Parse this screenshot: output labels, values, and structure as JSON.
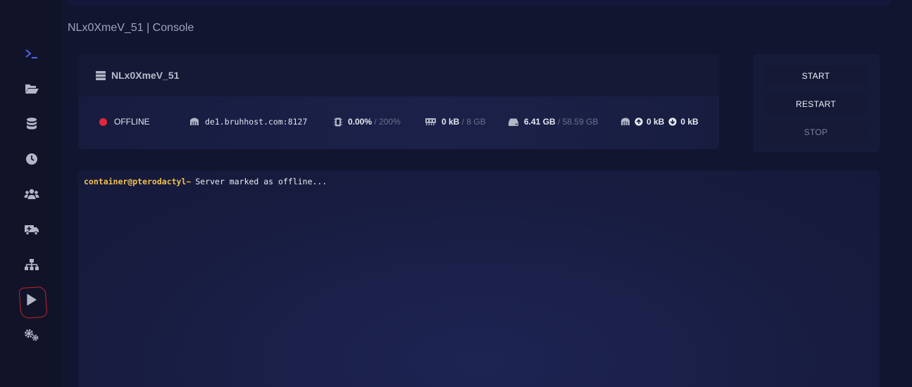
{
  "page": {
    "title": "NLx0XmeV_51 | Console"
  },
  "sidebar": {
    "items": [
      {
        "name": "console",
        "icon": "terminal-icon",
        "active": true
      },
      {
        "name": "files",
        "icon": "folder-open-icon"
      },
      {
        "name": "databases",
        "icon": "database-icon"
      },
      {
        "name": "schedules",
        "icon": "clock-icon"
      },
      {
        "name": "users",
        "icon": "users-icon"
      },
      {
        "name": "backups",
        "icon": "truck-icon"
      },
      {
        "name": "network",
        "icon": "network-icon"
      },
      {
        "name": "startup",
        "icon": "play-icon"
      },
      {
        "name": "settings",
        "icon": "cogs-icon"
      }
    ],
    "active_color": "#4f63e6",
    "icon_color": "#b2b6c6",
    "highlight_color": "#c2232f"
  },
  "server": {
    "name": "NLx0XmeV_51",
    "status": "OFFLINE",
    "status_color": "#e0293a",
    "address": "de1.bruhhost.com:8127",
    "cpu_value": "0.00%",
    "cpu_limit": "/ 200%",
    "memory_value": "0 kB",
    "memory_limit": "/ 8 GB",
    "disk_value": "6.41 GB",
    "disk_limit": "/ 58.59 GB",
    "net_up": "0 kB",
    "net_down": "0 kB"
  },
  "power": {
    "start_label": "START",
    "restart_label": "RESTART",
    "stop_label": "STOP"
  },
  "console": {
    "prompt": "container@pterodactyl~",
    "message": "Server marked as offline...",
    "prompt_color": "#f2c14e"
  }
}
